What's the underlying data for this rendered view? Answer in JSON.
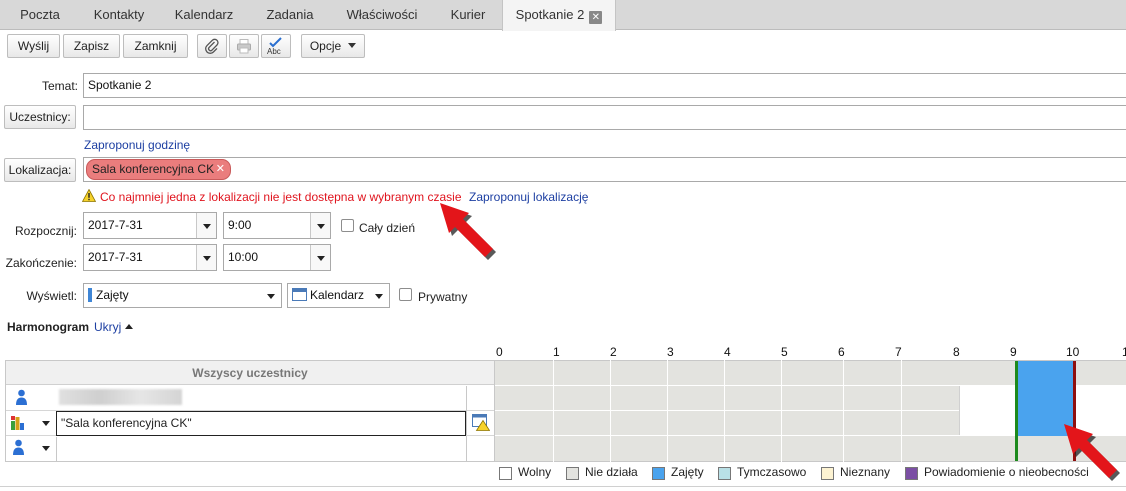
{
  "tabs": [
    "Poczta",
    "Kontakty",
    "Kalendarz",
    "Zadania",
    "Właściwości",
    "Kurier",
    "Spotkanie 2"
  ],
  "toolbar": {
    "send": "Wyślij",
    "save": "Zapisz",
    "close": "Zamknij",
    "spell_text": "Abc",
    "options": "Opcje"
  },
  "form": {
    "subject_label": "Temat:",
    "subject_value": "Spotkanie 2",
    "attendees_button": "Uczestnicy:",
    "attendees_value": "",
    "suggest_time": "Zaproponuj godzinę",
    "location_button": "Lokalizacja:",
    "location_tag": "Sala konferencyjna CK",
    "warning": "Co najmniej jedna z lokalizacji nie jest dostępna w wybranym czasie",
    "suggest_location": "Zaproponuj lokalizację",
    "start_label": "Rozpocznij:",
    "start_date": "2017-7-31",
    "start_time": "9:00",
    "all_day": "Cały dzień",
    "end_label": "Zakończenie:",
    "end_date": "2017-7-31",
    "end_time": "10:00",
    "show_label": "Wyświetl:",
    "show_value": "Zajęty",
    "calendar_value": "Kalendarz",
    "private": "Prywatny"
  },
  "schedule": {
    "title": "Harmonogram",
    "hide": "Ukryj",
    "header": "Wszyscy uczestnicy",
    "hours": [
      "0",
      "1",
      "2",
      "3",
      "4",
      "5",
      "6",
      "7",
      "8",
      "9",
      "10",
      "1"
    ],
    "room_value": "\"Sala konferencyjna CK\"",
    "legend": [
      "Wolny",
      "Nie działa",
      "Zajęty",
      "Tymczasowo",
      "Nieznany",
      "Powiadomienie o nieobecności"
    ]
  },
  "colors": {
    "busy": "#4aa3ee",
    "off": "#e3e3df",
    "tentative": "#b9e0e6",
    "unknown": "#fdf3d2",
    "away": "#7b4fa4",
    "start_line": "#1d8a1d",
    "end_line": "#8e0f0f",
    "warning": "#e0141e",
    "arrow": "#e3151a"
  },
  "icons": [
    "paperclip-icon",
    "printer-icon",
    "spellcheck-icon",
    "warning-icon",
    "person-icon",
    "room-icon",
    "room-alert-icon",
    "calendar-icon"
  ]
}
